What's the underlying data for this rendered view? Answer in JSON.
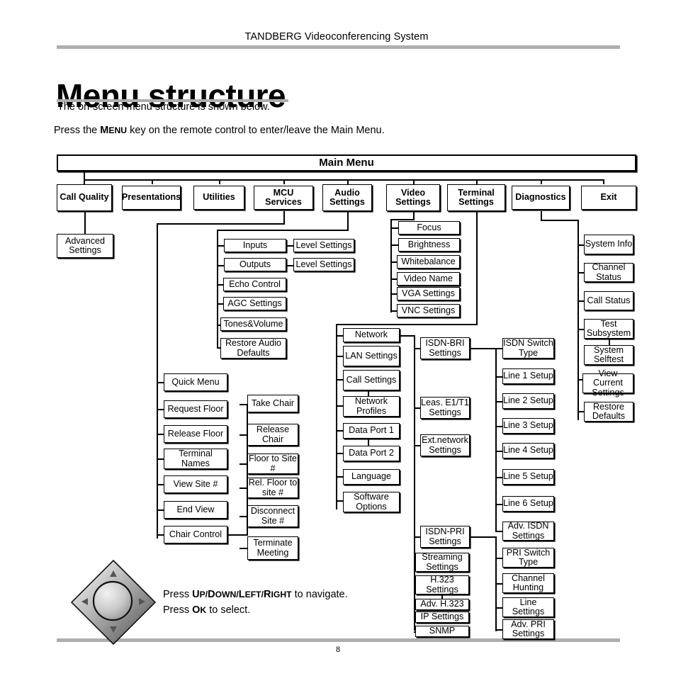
{
  "header": {
    "running_title": "TANDBERG Videoconferencing System",
    "page_heading": "Menu structure",
    "subtitle": "The on-screen menu structure is shown below.",
    "press_prefix": "Press the ",
    "press_key": "Menu",
    "press_suffix": " key on the remote control to enter/leave the Main Menu.",
    "page_number": "8"
  },
  "diagram": {
    "root": "Main Menu",
    "level1": [
      "Call Quality",
      "Presentations",
      "Utilities",
      "MCU Services",
      "Audio Settings",
      "Video Settings",
      "Terminal Settings",
      "Diagnostics",
      "Exit"
    ],
    "call_quality": [
      "Advanced Settings"
    ],
    "audio_settings": [
      "Inputs",
      "Outputs",
      "Echo Control",
      "AGC Settings",
      "Tones&Volume",
      "Restore Audio Defaults"
    ],
    "audio_level": [
      "Level Settings",
      "Level Settings"
    ],
    "video_settings": [
      "Focus",
      "Brightness",
      "Whitebalance",
      "Video Name",
      "VGA Settings",
      "VNC Settings"
    ],
    "mcu_services": [
      "Quick Menu",
      "Request Floor",
      "Release Floor",
      "Terminal Names",
      "View  Site #",
      "End  View",
      "Chair Control"
    ],
    "chair_control": [
      "Take Chair",
      "Release Chair",
      "Floor to Site #",
      "Rel. Floor to site #",
      "Disconnect Site #",
      "Terminate Meeting"
    ],
    "terminal_settings": [
      "Network",
      "LAN Settings",
      "Call Settings",
      "Network Profiles",
      "Data Port 1",
      "Data Port 2",
      "Language",
      "Software Options"
    ],
    "network": [
      "ISDN-BRI Settings",
      "Leas. E1/T1 Settings",
      "Ext.network Settings",
      "ISDN-PRI Settings",
      "Streaming Settings",
      "H.323 Settings",
      "Adv. H.323",
      "IP Settings",
      "SNMP"
    ],
    "isdn_bri": [
      "ISDN Switch Type",
      "Line 1 Setup",
      "Line 2 Setup",
      "Line 3 Setup",
      "Line 4 Setup",
      "Line 5 Setup",
      "Line 6 Setup",
      "Adv. ISDN Settings"
    ],
    "isdn_pri": [
      "PRI Switch Type",
      "Channel Hunting",
      "Line Settings",
      "Adv. PRI Settings"
    ],
    "diagnostics": [
      "System Info",
      "Channel Status",
      "Call Status",
      "Test Subsystem",
      "System Selftest",
      "View Current Settings",
      "Restore Defaults"
    ]
  },
  "navigation": {
    "line1_prefix": "Press ",
    "line1_keys": "Up/Down/Left/Right",
    "line1_suffix": " to navigate.",
    "line2_prefix": "Press ",
    "line2_keys": "Ok",
    "line2_suffix": " to select.",
    "remote_icon": "dpad-diamond-icon"
  }
}
